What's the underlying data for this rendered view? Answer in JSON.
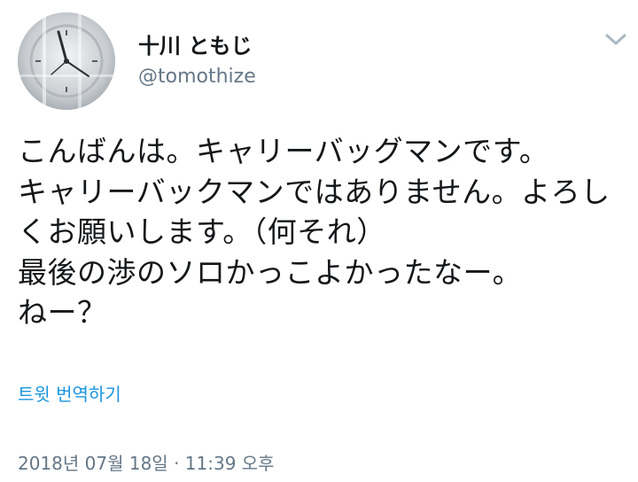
{
  "tweet": {
    "display_name": "十川 ともじ",
    "handle": "@tomothize",
    "text": "こんばんは。キャリーバッグマンです。\nキャリーバックマンではありません。よろしくお願いします。（何それ）\n最後の渉のソロかっこよかったなー。\nねー？",
    "translate_link": "트윗 번역하기",
    "timestamp": "2018년 07월 18일 · 11:39 오후"
  },
  "icons": {
    "menu": "chevron-down-icon",
    "avatar": "avatar-image"
  },
  "colors": {
    "link": "#1b95e0",
    "secondary_text": "#657786",
    "primary_text": "#14171a",
    "chevron": "#aab8c2"
  }
}
